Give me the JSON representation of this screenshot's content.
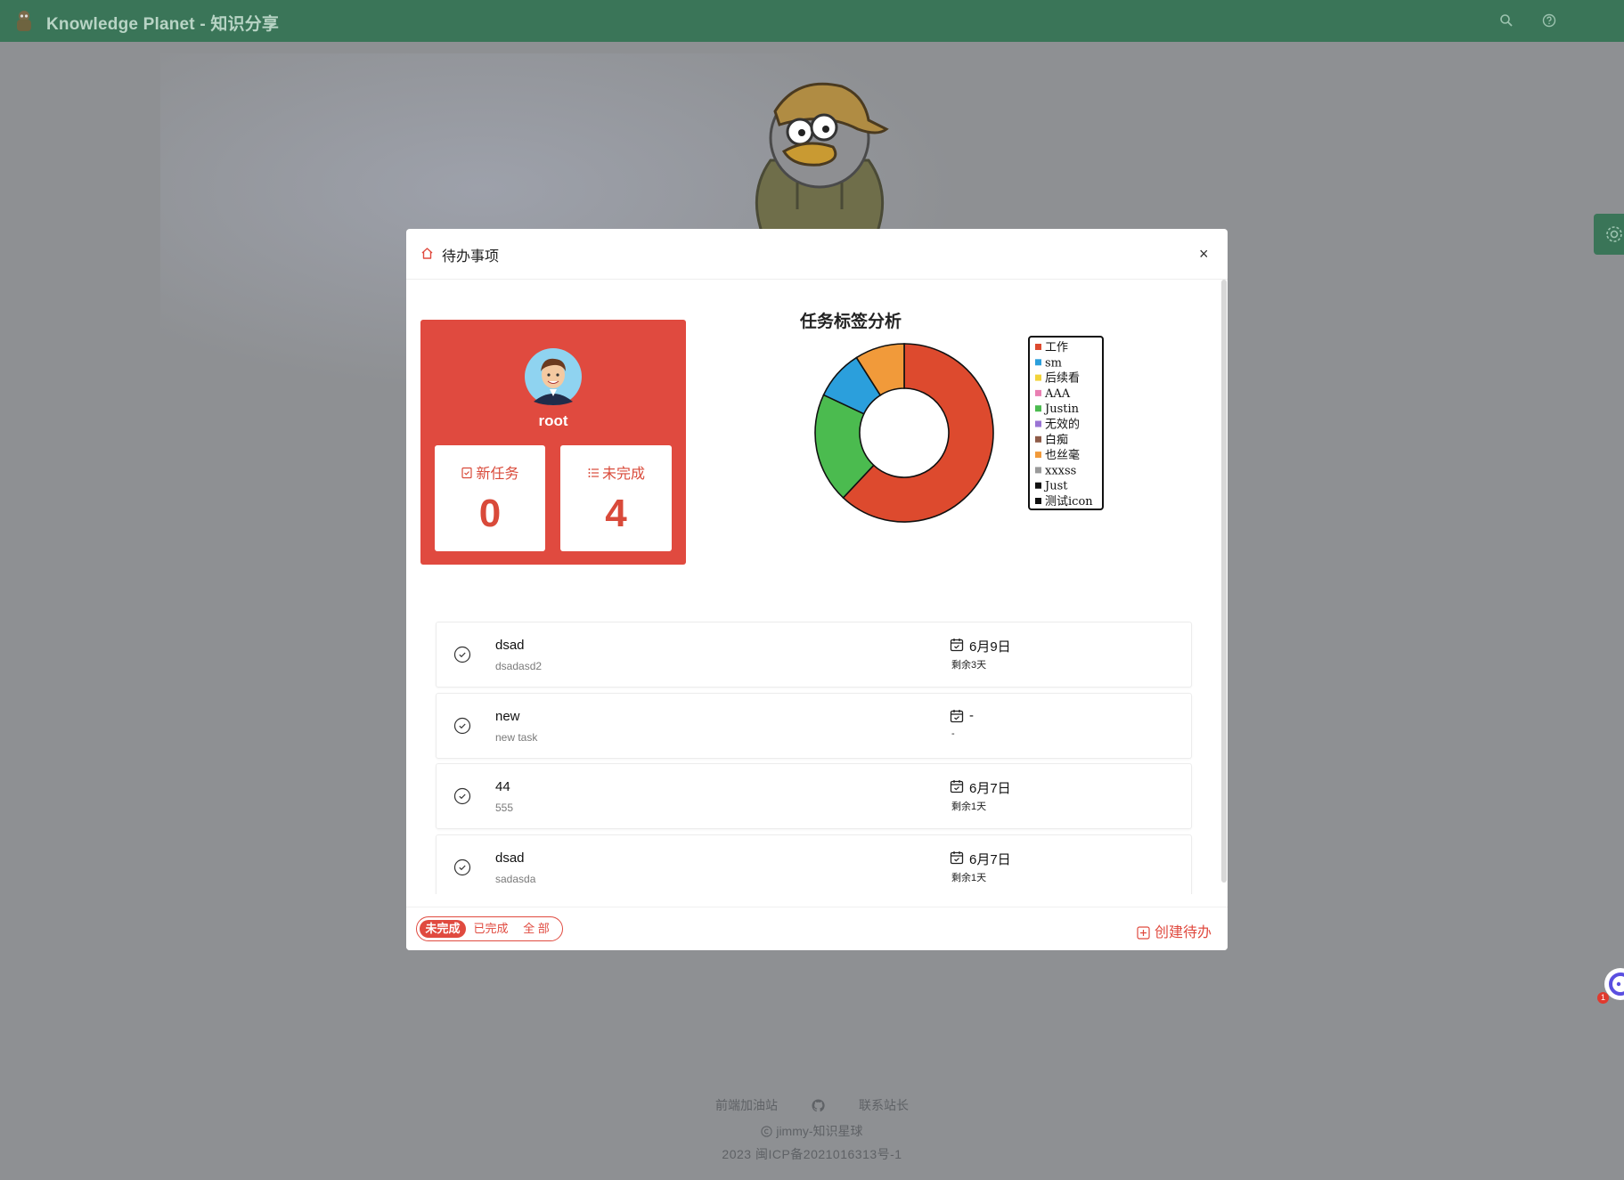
{
  "app": {
    "title": "Knowledge Planet - 知识分享"
  },
  "modal": {
    "title": "待办事项",
    "close_label": "×"
  },
  "profile": {
    "username": "root",
    "stats": [
      {
        "label": "新任务",
        "value": "0"
      },
      {
        "label": "未完成",
        "value": "4"
      }
    ]
  },
  "chart_data": {
    "type": "pie",
    "title": "任务标签分析",
    "legend_position": "right",
    "series": [
      {
        "name": "工作",
        "value": 62,
        "color": "#dd4a2e"
      },
      {
        "name": "sm",
        "value": 0,
        "color": "#2b9fdc"
      },
      {
        "name": "后续看",
        "value": 0,
        "color": "#f2d33a"
      },
      {
        "name": "AAA",
        "value": 0,
        "color": "#e97fb2"
      },
      {
        "name": "Justin",
        "value": 20,
        "color": "#4bbb4f"
      },
      {
        "name": "无效的",
        "value": 0,
        "color": "#9a74d4"
      },
      {
        "name": "白痴",
        "value": 0,
        "color": "#8e5b48"
      },
      {
        "name": "也丝毫",
        "value": 9,
        "color": "#f19a3a"
      },
      {
        "name": "xxxss",
        "value": 0,
        "color": "#9a9a9a"
      },
      {
        "name": "Just",
        "value": 0,
        "color": "#111111"
      },
      {
        "name": "测试icon",
        "value": 0,
        "color": "#111111"
      }
    ],
    "visible_slices": [
      {
        "name": "工作",
        "value": 62,
        "color": "#dd4a2e"
      },
      {
        "name": "Justin",
        "value": 20,
        "color": "#4bbb4f"
      },
      {
        "name": "sm",
        "value": 9,
        "color": "#2b9fdc"
      },
      {
        "name": "也丝毫",
        "value": 9,
        "color": "#f19a3a"
      }
    ]
  },
  "tasks": [
    {
      "title": "dsad",
      "desc": "dsadasd2",
      "date": "6月9日",
      "remain": "剩余3天"
    },
    {
      "title": "new",
      "desc": "new task",
      "date": "-",
      "remain": "-"
    },
    {
      "title": "44",
      "desc": "555",
      "date": "6月7日",
      "remain": "剩余1天"
    },
    {
      "title": "dsad",
      "desc": "sadasda",
      "date": "6月7日",
      "remain": "剩余1天"
    }
  ],
  "filter": {
    "options": [
      "未完成",
      "已完成",
      "全 部"
    ],
    "selected": "未完成"
  },
  "create_label": "创建待办",
  "footer": {
    "link1": "前端加油站",
    "link2": "联系站长",
    "copyright": "jimmy-知识星球",
    "icp": "2023 闽ICP备2021016313号-1"
  },
  "notification_count": "1",
  "colors": {
    "topbar": "#3a7558",
    "accent": "#e04a3f",
    "overlay": "#8e9093"
  }
}
